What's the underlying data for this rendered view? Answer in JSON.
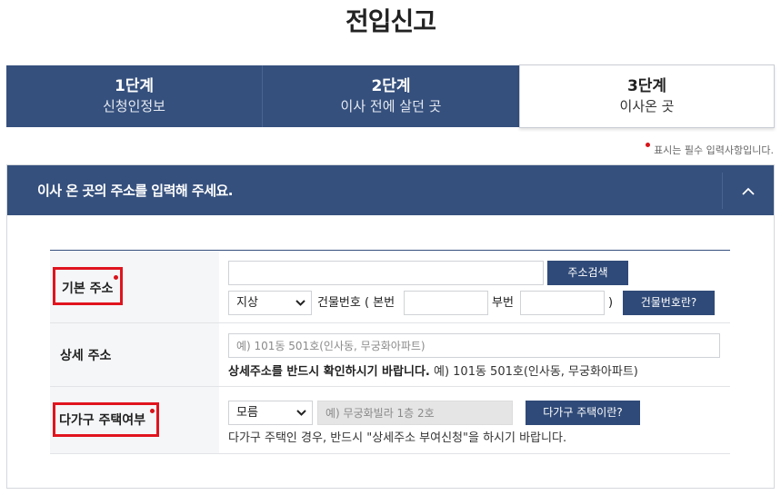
{
  "page": {
    "title": "전입신고"
  },
  "steps": [
    {
      "num": "1단계",
      "desc": "신청인정보"
    },
    {
      "num": "2단계",
      "desc": "이사 전에 살던 곳"
    },
    {
      "num": "3단계",
      "desc": "이사온 곳"
    }
  ],
  "required_note": "표시는 필수 입력사항입니다.",
  "panel": {
    "title": "이사 온 곳의 주소를 입력해 주세요."
  },
  "form": {
    "basic_address": {
      "label": "기본 주소",
      "address_value": "",
      "search_button": "주소검색",
      "land_type": "지상",
      "building_no_label": "건물번호 ( 본번",
      "main_no_value": "",
      "sub_no_label": "부번",
      "sub_no_value": "",
      "close_paren": ")",
      "building_no_help_button": "건물번호란?"
    },
    "detail_address": {
      "label": "상세 주소",
      "placeholder": "예) 101동 501호(인사동, 무궁화아파트)",
      "notice_bold": "상세주소를 반드시 확인하시기 바랍니다.",
      "notice_example": "예) 101동 501호(인사동, 무궁화아파트)"
    },
    "multi_household": {
      "label": "다가구 주택여부",
      "select_value": "모름",
      "placeholder": "예) 무궁화빌라 1층 2호",
      "help_button": "다가구 주택이란?",
      "notice": "다가구 주택인 경우, 반드시 \"상세주소 부여신청\"을 하시기 바랍니다."
    }
  },
  "colors": {
    "primary": "#35507d",
    "button": "#2f4a78",
    "required": "#d7141a"
  }
}
